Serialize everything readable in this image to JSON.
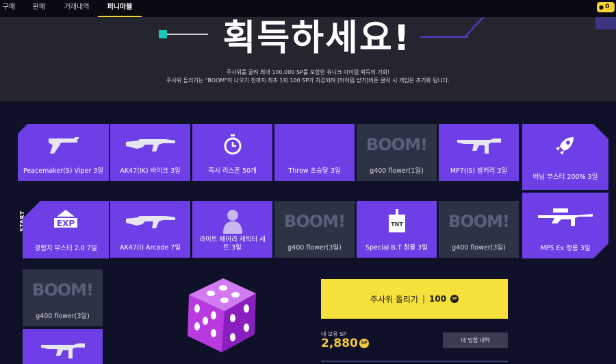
{
  "nav": {
    "tabs": [
      {
        "label": "구매"
      },
      {
        "label": "판매"
      },
      {
        "label": "거래내역"
      },
      {
        "label": "퍼니마블"
      }
    ],
    "coin_count": "0"
  },
  "banner": {
    "title": "획득하세요!",
    "desc_line1": "주사위를 굴려 최대 100,000 SP를 포함한 유니크 아이템 획득의 기회!",
    "desc_line2": "주사위 돌리기는 \"BOOM\"이 나오기 전까지 최초 1회 100 SP가 차감되며 [아이템 받기]버튼 클릭 시 게임은 초기화 됩니다."
  },
  "board": {
    "start_label": "START",
    "boom_text": "BOOM!",
    "tiles": [
      {
        "label": "Peacemaker(S) Viper 3일",
        "icon": "pistol-icon"
      },
      {
        "label": "AK47(IK) 바이크 3일",
        "icon": "rifle-icon"
      },
      {
        "label": "즉시 리스폰 50개",
        "icon": "stopwatch-icon"
      },
      {
        "label": "Throw 초승달 3일",
        "icon": "crescent-moon-icon"
      },
      {
        "label": "g400 flower(1일)",
        "icon": "boom-grenade-icon"
      },
      {
        "label": "MP7(IS) 발키리 3일",
        "icon": "smg-icon"
      },
      {
        "label": "버닝 부스터 200% 3일",
        "icon": "rocket-icon"
      },
      {
        "label": "경험치 부스터 2.0 7일",
        "icon": "exp-icon"
      },
      {
        "label": "AK47(I) Arcade 7일",
        "icon": "rifle-icon"
      },
      {
        "label": "라이트 페어리 캐릭터 세트 3일",
        "icon": "character-icon"
      },
      {
        "label": "g400 flower(3일)",
        "icon": "boom-grenade-icon"
      },
      {
        "label": "Special B.T 청룡 3일",
        "icon": "tnt-icon"
      },
      {
        "label": "g400 flower(3일)",
        "icon": "boom-grenade-icon"
      },
      {
        "label": "MP5 Ex 청룡 3일",
        "icon": "sniper-icon"
      },
      {
        "label": "g400 flower(3일)",
        "icon": "boom-grenade-icon"
      },
      {
        "label": "",
        "icon": "smg-icon"
      }
    ]
  },
  "roll": {
    "button_label": "주사위 돌리기",
    "separator": "|",
    "cost": "100",
    "coin_symbol": "SP"
  },
  "wallet": {
    "label": "내 보유 SP",
    "value": "2,880",
    "coin_symbol": "SP",
    "history_button": "내 당첨 내역"
  },
  "colors": {
    "accent_yellow": "#f5e03c",
    "tile_purple": "#6e3fe6",
    "tile_gray": "#2e3245",
    "background": "#0e1128"
  }
}
